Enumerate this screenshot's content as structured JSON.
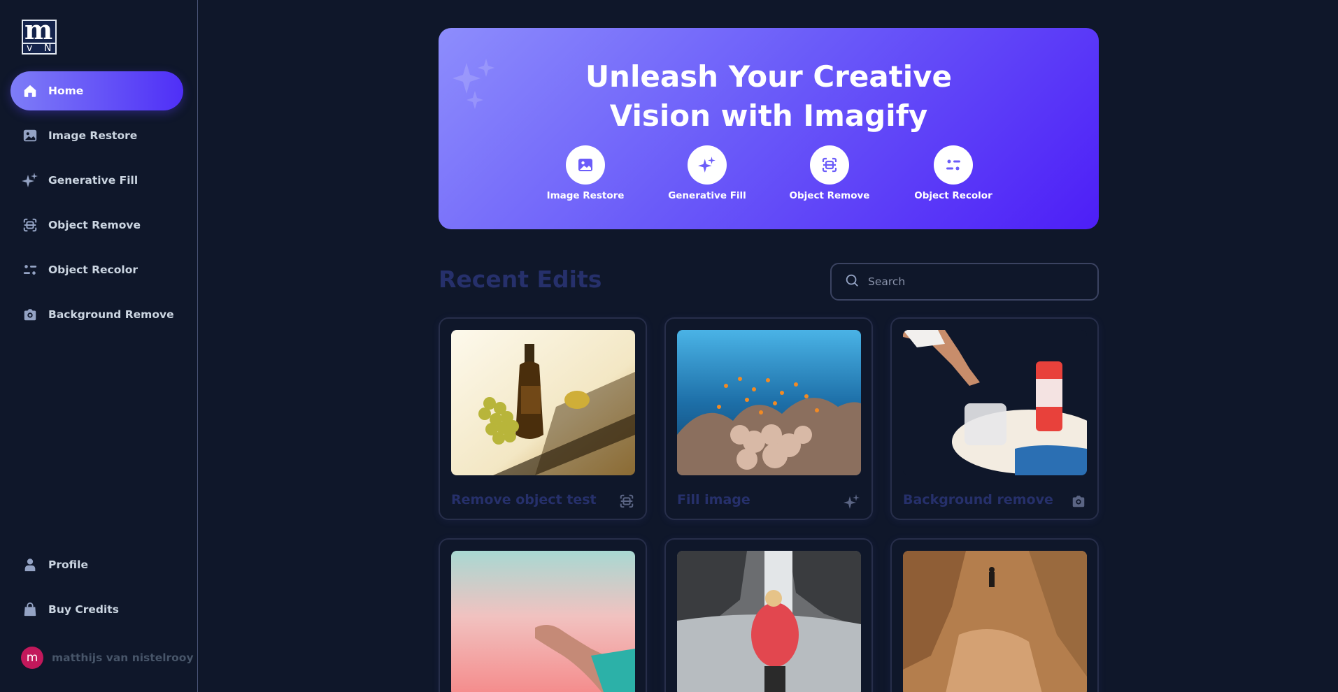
{
  "brand": {
    "logo_big": "m",
    "logo_small_left": "v",
    "logo_small_right": "N"
  },
  "sidebar": {
    "items": [
      {
        "label": "Home",
        "icon": "home-icon",
        "active": true
      },
      {
        "label": "Image Restore",
        "icon": "image-icon"
      },
      {
        "label": "Generative Fill",
        "icon": "stars-icon"
      },
      {
        "label": "Object Remove",
        "icon": "scan-icon"
      },
      {
        "label": "Object Recolor",
        "icon": "filter-icon"
      },
      {
        "label": "Background Remove",
        "icon": "camera-icon"
      }
    ],
    "bottom": [
      {
        "label": "Profile",
        "icon": "user-icon"
      },
      {
        "label": "Buy Credits",
        "icon": "bag-icon"
      }
    ],
    "user": {
      "initial": "m",
      "name": "matthijs van nistelrooy"
    }
  },
  "hero": {
    "title_line1": "Unleash Your Creative",
    "title_line2": "Vision with Imagify",
    "tools": [
      {
        "label": "Image Restore",
        "icon": "image-icon"
      },
      {
        "label": "Generative Fill",
        "icon": "stars-icon"
      },
      {
        "label": "Object Remove",
        "icon": "scan-icon"
      },
      {
        "label": "Object Recolor",
        "icon": "filter-icon"
      }
    ]
  },
  "recent": {
    "title": "Recent Edits",
    "search_placeholder": "Search",
    "cards": [
      {
        "title": "Remove object test",
        "icon": "scan-icon",
        "image": "bottle-grapes-photo"
      },
      {
        "title": "Fill image",
        "icon": "stars-icon",
        "image": "coral-reef-photo"
      },
      {
        "title": "Background remove",
        "icon": "camera-icon",
        "image": "hand-drink-can-photo"
      },
      {
        "title": "",
        "icon": "",
        "image": "hand-pink-sky-photo"
      },
      {
        "title": "",
        "icon": "",
        "image": "waterfall-woman-photo"
      },
      {
        "title": "",
        "icon": "",
        "image": "desert-canyon-photo"
      }
    ]
  },
  "colors": {
    "accent_start": "#8d8dfc",
    "accent_end": "#4d1ef7",
    "background": "#0f172a",
    "muted_title": "#26306b"
  }
}
